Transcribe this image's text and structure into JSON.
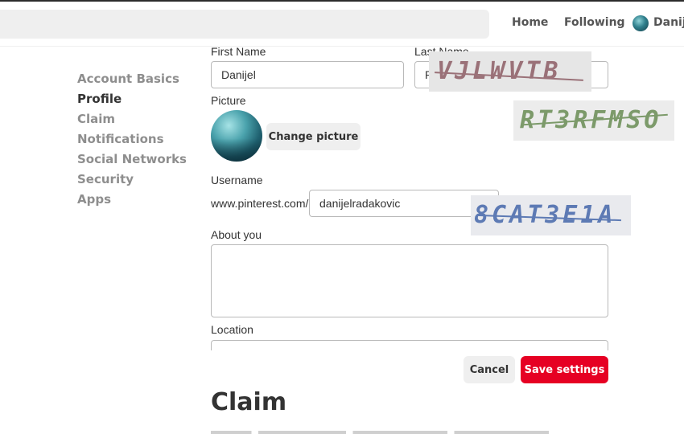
{
  "header": {
    "nav": {
      "home": "Home",
      "following": "Following",
      "user": "Danijel"
    }
  },
  "sidebar": {
    "items": [
      {
        "label": "Account Basics",
        "active": false
      },
      {
        "label": "Profile",
        "active": true
      },
      {
        "label": "Claim",
        "active": false
      },
      {
        "label": "Notifications",
        "active": false
      },
      {
        "label": "Social Networks",
        "active": false
      },
      {
        "label": "Security",
        "active": false
      },
      {
        "label": "Apps",
        "active": false
      }
    ]
  },
  "profile": {
    "first_name_label": "First Name",
    "first_name_value": "Danijel",
    "last_name_label": "Last Name",
    "last_name_value": "R",
    "picture_label": "Picture",
    "change_picture_label": "Change picture",
    "username_label": "Username",
    "username_prefix": "www.pinterest.com/",
    "username_value": "danijelradakovic",
    "about_label": "About you",
    "about_value": "",
    "location_label": "Location",
    "location_value": ""
  },
  "actions": {
    "cancel_label": "Cancel",
    "save_label": "Save settings"
  },
  "captchas": [
    {
      "text": "VJLWVTB",
      "color": "#9a7178"
    },
    {
      "text": "RT3RFMSO",
      "color": "#7c9a6a"
    },
    {
      "text": "8CAT3E1A",
      "color": "#5d7ab4"
    }
  ],
  "claim_section": {
    "title": "Claim"
  },
  "colors": {
    "accent": "#e60023",
    "text": "#333333",
    "muted": "#8e8e8e",
    "button_gray": "#efefef"
  }
}
